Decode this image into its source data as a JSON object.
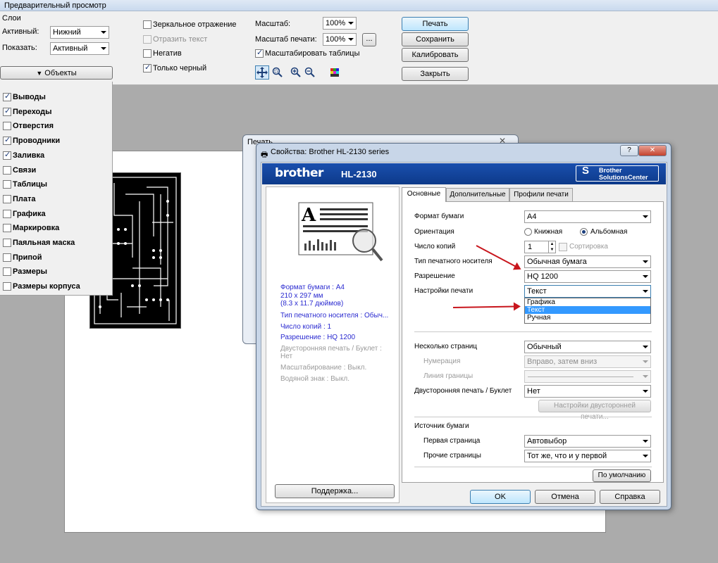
{
  "window": {
    "title": "Предварительный просмотр"
  },
  "layers": {
    "heading": "Слои",
    "active_label": "Активный:",
    "active_value": "Нижний",
    "show_label": "Показать:",
    "show_value": "Активный"
  },
  "options": {
    "mirror": "Зеркальное отражение",
    "reflect_text": "Отразить текст",
    "negative": "Негатив",
    "black_only": "Только черный"
  },
  "scale": {
    "scale_label": "Масштаб:",
    "scale_value": "100%",
    "print_scale_label": "Масштаб печати:",
    "print_scale_value": "100%",
    "more_button": "...",
    "scale_tables": "Масштабировать таблицы"
  },
  "actions": {
    "print": "Печать",
    "save": "Сохранить",
    "calibrate": "Калибровать",
    "close": "Закрыть"
  },
  "objects": {
    "header": "Объекты",
    "items": [
      {
        "label": "Выводы",
        "checked": true
      },
      {
        "label": "Переходы",
        "checked": true
      },
      {
        "label": "Отверстия",
        "checked": false
      },
      {
        "label": "Проводники",
        "checked": true
      },
      {
        "label": "Заливка",
        "checked": true
      },
      {
        "label": "Связи",
        "checked": false
      },
      {
        "label": "Таблицы",
        "checked": false
      },
      {
        "label": "Плата",
        "checked": false
      },
      {
        "label": "Графика",
        "checked": false
      },
      {
        "label": "Маркировка",
        "checked": false
      },
      {
        "label": "Паяльная маска",
        "checked": false
      },
      {
        "label": "Припой",
        "checked": false
      },
      {
        "label": "Размеры",
        "checked": false
      },
      {
        "label": "Размеры корпуса",
        "checked": false
      }
    ]
  },
  "print_dialog": {
    "title": "Печать",
    "close": "✕"
  },
  "props_dialog": {
    "title": "Свойства: Brother HL-2130 series",
    "help_btn": "?",
    "close_btn": "✕",
    "brand": "brother",
    "model": "HL-2130",
    "solutions_1": "Brother",
    "solutions_2": "SolutionsCenter",
    "tabs": [
      "Основные",
      "Дополнительные",
      "Профили печати"
    ],
    "info": {
      "paper": "Формат бумаги : A4",
      "size_mm": "210 x 297 мм",
      "size_in": "(8.3 x 11.7 дюймов)",
      "media": "Тип печатного носителя : Обыч...",
      "copies": "Число копий : 1",
      "resolution": "Разрешение : HQ 1200",
      "duplex": "Двусторонняя печать / Буклет :",
      "duplex_val": "Нет",
      "scaling": "Масштабирование : Выкл.",
      "watermark": "Водяной знак : Выкл."
    },
    "support_button": "Поддержка...",
    "fields": {
      "paper_size_label": "Формат бумаги",
      "paper_size_value": "A4",
      "orientation_label": "Ориентация",
      "portrait": "Книжная",
      "landscape": "Альбомная",
      "copies_label": "Число копий",
      "copies_value": "1",
      "collate": "Сортировка",
      "media_label": "Тип печатного носителя",
      "media_value": "Обычная бумага",
      "resolution_label": "Разрешение",
      "resolution_value": "HQ 1200",
      "print_settings_label": "Настройки печати",
      "print_settings_value": "Текст",
      "print_settings_options": [
        "Графика",
        "Текст",
        "Ручная"
      ],
      "multi_page_label": "Несколько страниц",
      "multi_page_value": "Обычный",
      "page_order_label": "Нумерация",
      "page_order_value": "Вправо, затем вниз",
      "border_line_label": "Линия границы",
      "duplex_label": "Двусторонняя печать / Буклет",
      "duplex_value": "Нет",
      "duplex_settings_button": "Настройки двусторонней печати...",
      "paper_source_label": "Источник бумаги",
      "first_page_label": "Первая страница",
      "first_page_value": "Автовыбор",
      "other_pages_label": "Прочие страницы",
      "other_pages_value": "Тот же, что и у первой",
      "default_button": "По умолчанию"
    },
    "footer": {
      "ok": "OK",
      "cancel": "Отмена",
      "help": "Справка"
    }
  }
}
